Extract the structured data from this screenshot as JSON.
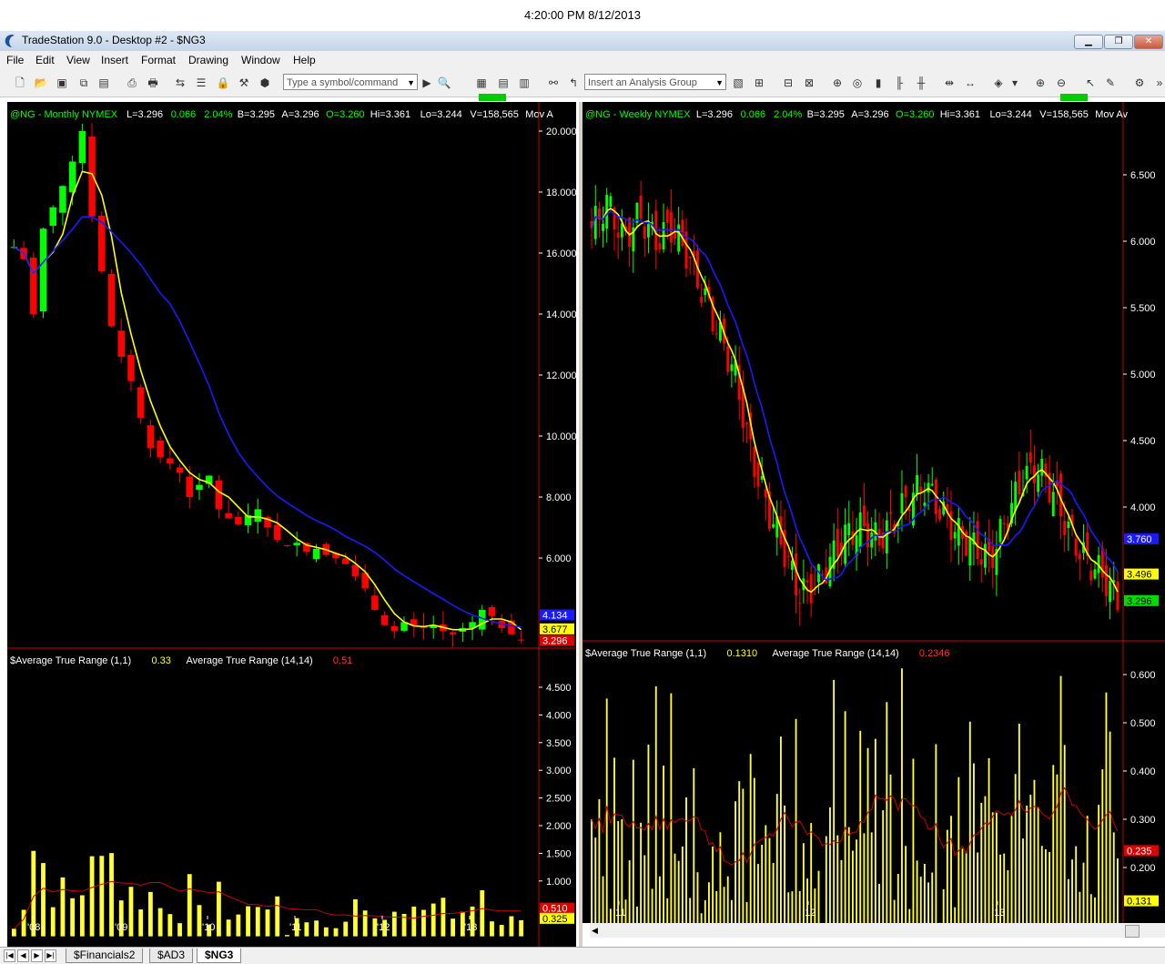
{
  "clock": "4:20:00 PM 8/12/2013",
  "window": {
    "title": "TradeStation 9.0 - Desktop #2 - $NG3"
  },
  "menu": [
    "File",
    "Edit",
    "View",
    "Insert",
    "Format",
    "Drawing",
    "Window",
    "Help"
  ],
  "toolbar": {
    "symbol_placeholder": "Type a symbol/command",
    "analysis_group": "Insert an Analysis Group"
  },
  "colors": {
    "background": "#000000",
    "up": "#00ff00",
    "down": "#ff0000",
    "ma_fast": "#ffff00",
    "ma_slow": "#1a1aff",
    "atr_bar": "#ffff33",
    "atr_line": "#cc0000",
    "axis_line": "#cc0000"
  },
  "left_chart": {
    "status": [
      "@NG - Monthly  NYMEX",
      "L=3.296",
      "0.066",
      "2.04%",
      "B=3.295",
      "A=3.296",
      "O=3.260",
      "Hi=3.361",
      "Lo=3.244",
      "V=158,565",
      "Mov A"
    ],
    "price_ticks": [
      "20.000",
      "18.000",
      "16.000",
      "14.000",
      "12.000",
      "10.000",
      "8.000",
      "6.000"
    ],
    "labels": {
      "ma_slow": "4.134",
      "ma_fast": "3.677",
      "last": "3.296"
    },
    "indicator": {
      "name1": "$Average True Range (1,1)",
      "value1": "0.33",
      "name2": "Average True Range (14,14)",
      "value2": "0.51"
    },
    "atr_ticks": [
      "4.500",
      "4.000",
      "3.500",
      "3.000",
      "2.500",
      "2.000",
      "1.500",
      "1.000"
    ],
    "atr_labels": {
      "line": "0.510",
      "bar": "0.325"
    },
    "x_ticks": [
      "'08",
      "'09",
      "'10",
      "'11",
      "'12",
      "'13"
    ]
  },
  "right_chart": {
    "status": [
      "@NG - Weekly  NYMEX",
      "L=3.296",
      "0.066",
      "2.04%",
      "B=3.295",
      "A=3.296",
      "O=3.260",
      "Hi=3.361",
      "Lo=3.244",
      "V=158,565",
      "Mov Av"
    ],
    "price_ticks": [
      "6.500",
      "6.000",
      "5.500",
      "5.000",
      "4.500",
      "4.000"
    ],
    "labels": {
      "ma_slow": "3.760",
      "ma_fast": "3.496",
      "last": "3.296"
    },
    "indicator": {
      "name1": "$Average True Range (1,1)",
      "value1": "0.1310",
      "name2": "Average True Range (14,14)",
      "value2": "0.2346"
    },
    "atr_ticks": [
      "0.600",
      "0.500",
      "0.400",
      "0.300",
      "0.200"
    ],
    "atr_labels": {
      "line": "0.235",
      "bar": "0.131"
    },
    "x_ticks": [
      "'11",
      "'12",
      "'13"
    ]
  },
  "tabs": [
    "$Financials2",
    "$AD3",
    "$NG3"
  ],
  "chart_data": [
    {
      "type": "candlestick",
      "title": "@NG - Monthly",
      "ylim": [
        3.0,
        20.5
      ],
      "series": [
        {
          "name": "Mov Avg fast",
          "values": [
            17.0,
            16.2,
            14.6,
            13.2,
            11.9,
            10.9,
            10.1,
            9.6,
            9.3,
            9.1,
            8.6,
            8.1,
            7.8,
            7.6,
            7.6,
            7.4,
            7.2,
            6.9,
            6.6,
            6.4,
            6.3,
            6.4,
            6.2,
            5.9,
            5.5,
            5.0,
            4.6,
            4.2,
            3.8,
            3.7,
            3.6,
            3.6,
            3.7,
            3.7,
            3.6,
            3.5,
            3.5,
            3.6,
            3.7,
            3.7,
            3.7,
            3.7,
            3.6,
            3.5
          ]
        },
        {
          "name": "Mov Avg slow",
          "values": [
            17.3,
            17.2,
            17.0,
            16.7,
            16.3,
            15.7,
            15.0,
            14.2,
            13.4,
            12.6,
            11.9,
            11.2,
            10.6,
            10.1,
            9.6,
            9.2,
            8.8,
            8.4,
            8.0,
            7.7,
            7.4,
            7.1,
            6.9,
            6.7,
            6.4,
            6.1,
            5.7,
            5.3,
            4.9,
            4.6,
            4.4,
            4.3,
            4.25,
            4.2,
            4.2,
            4.2,
            4.2,
            4.2,
            4.2,
            4.2,
            4.2,
            4.2,
            4.15,
            4.13
          ]
        }
      ]
    },
    {
      "type": "candlestick",
      "title": "@NG - Weekly",
      "ylim": [
        3.0,
        7.0
      ]
    }
  ]
}
